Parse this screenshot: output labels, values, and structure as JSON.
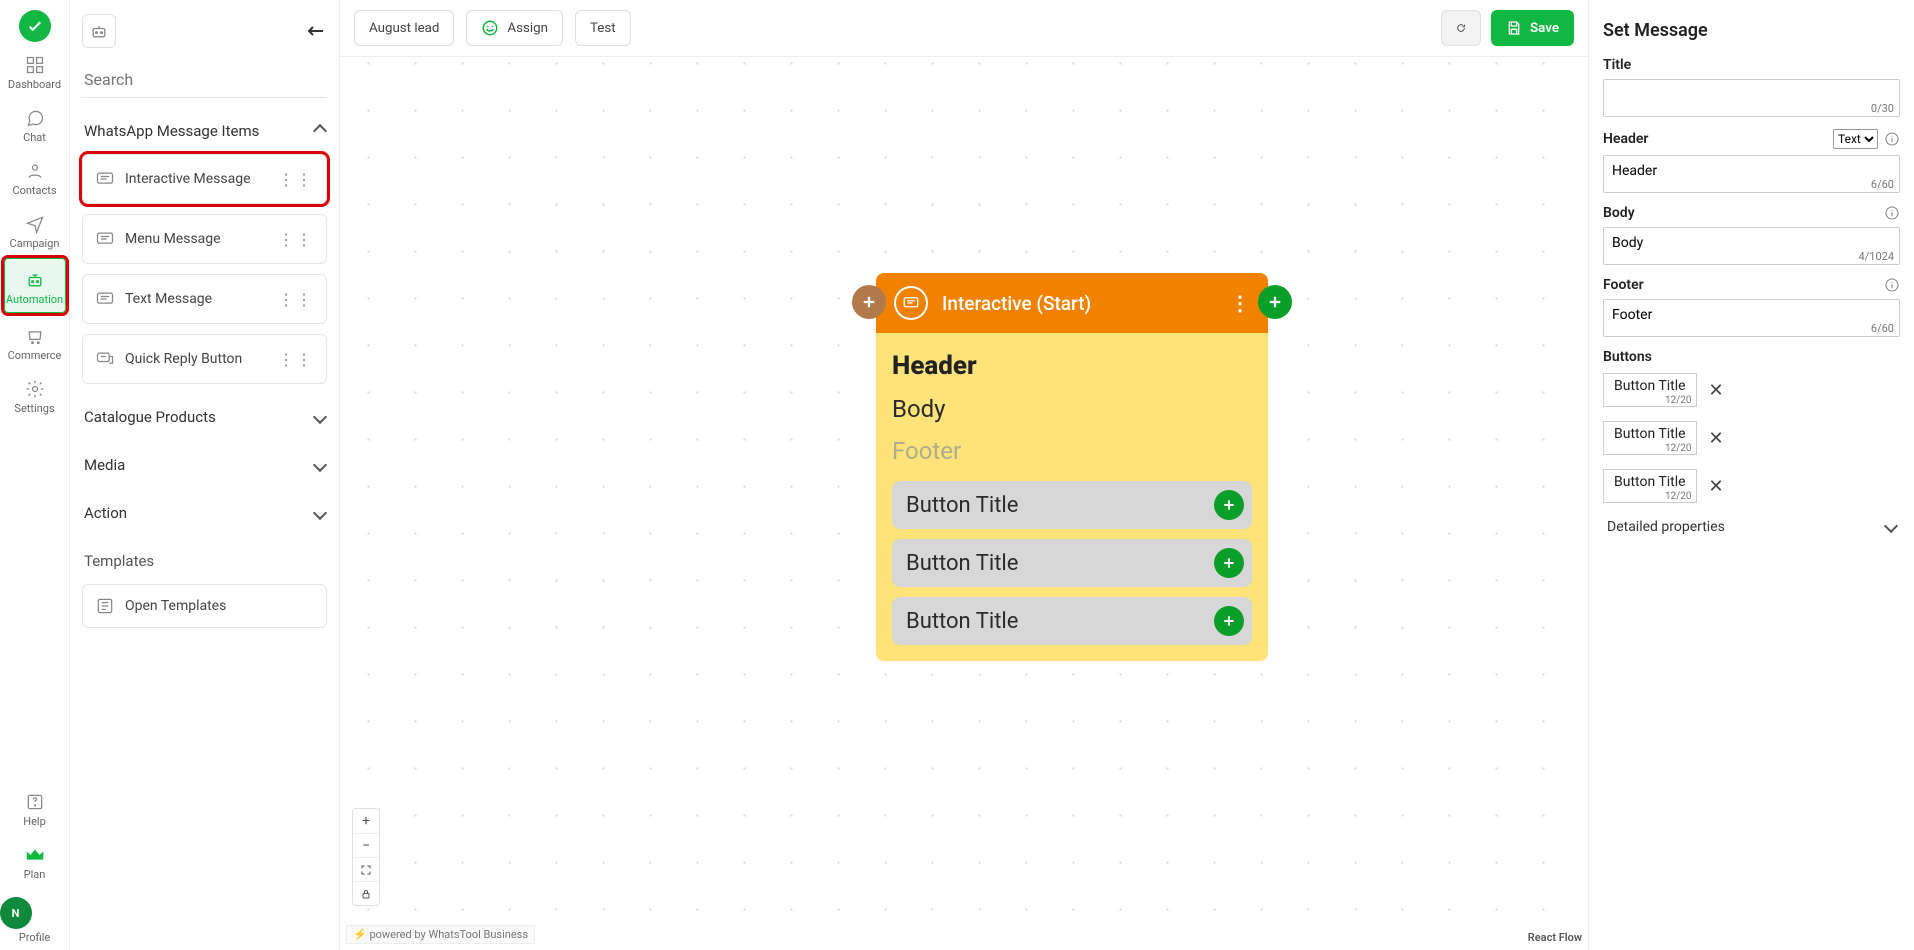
{
  "rail": {
    "items": [
      {
        "label": "Dashboard"
      },
      {
        "label": "Chat"
      },
      {
        "label": "Contacts"
      },
      {
        "label": "Campaign"
      },
      {
        "label": "Automation"
      },
      {
        "label": "Commerce"
      },
      {
        "label": "Settings"
      }
    ],
    "help": "Help",
    "plan": "Plan",
    "profile": "Profile",
    "avatar_initial": "N"
  },
  "picker": {
    "search_placeholder": "Search",
    "section": "WhatsApp Message Items",
    "items": [
      {
        "label": "Interactive Message"
      },
      {
        "label": "Menu Message"
      },
      {
        "label": "Text Message"
      },
      {
        "label": "Quick Reply Button"
      }
    ],
    "collapsed_sections": [
      "Catalogue Products",
      "Media",
      "Action"
    ],
    "templates_label": "Templates",
    "open_templates": "Open Templates"
  },
  "toolbar": {
    "flow_name": "August lead",
    "assign": "Assign",
    "test": "Test",
    "save": "Save"
  },
  "node": {
    "title": "Interactive (Start)",
    "header": "Header",
    "body": "Body",
    "footer": "Footer",
    "buttons": [
      "Button Title",
      "Button Title",
      "Button Title"
    ]
  },
  "canvas": {
    "attribution_prefix": "powered by ",
    "attribution_name": "WhatsTool Business",
    "react_flow": "React Flow"
  },
  "props": {
    "panel_title": "Set Message",
    "title_label": "Title",
    "title_value": "",
    "title_count": "0/30",
    "header_label": "Header",
    "header_type_options": [
      "Text"
    ],
    "header_value": "Header",
    "header_count": "6/60",
    "body_label": "Body",
    "body_value": "Body",
    "body_count": "4/1024",
    "footer_label": "Footer",
    "footer_value": "Footer",
    "footer_count": "6/60",
    "buttons_label": "Buttons",
    "button_chips": [
      {
        "label": "Button Title",
        "count": "12/20"
      },
      {
        "label": "Button Title",
        "count": "12/20"
      },
      {
        "label": "Button Title",
        "count": "12/20"
      }
    ],
    "detailed": "Detailed properties"
  }
}
